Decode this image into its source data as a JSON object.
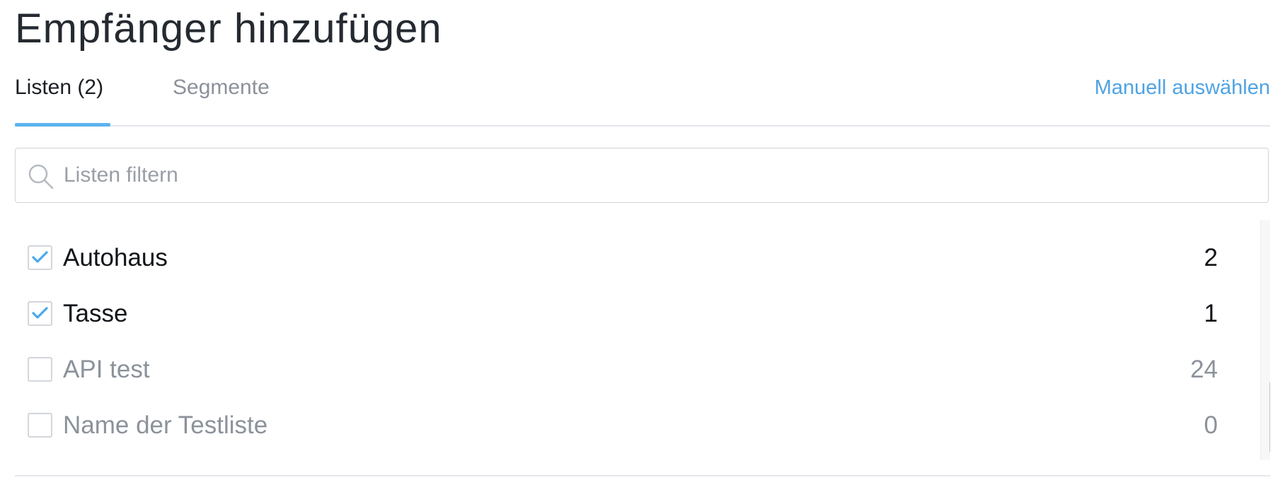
{
  "dialog": {
    "title": "Empfänger hinzufügen"
  },
  "tabs": [
    {
      "label": "Listen (2)",
      "active": true
    },
    {
      "label": "Segmente",
      "active": false
    }
  ],
  "manual_select": {
    "label": "Manuell auswählen"
  },
  "search": {
    "placeholder": "Listen filtern",
    "value": "",
    "icon": "search-icon"
  },
  "lists": [
    {
      "name": "Autohaus",
      "count": "2",
      "checked": true
    },
    {
      "name": "Tasse",
      "count": "1",
      "checked": true
    },
    {
      "name": "API test",
      "count": "24",
      "checked": false
    },
    {
      "name": "Name der Testliste",
      "count": "0",
      "checked": false
    }
  ],
  "colors": {
    "accent": "#5bb3ee",
    "link": "#4fa3e3",
    "text_primary": "#111418",
    "text_muted": "#8c929a"
  }
}
